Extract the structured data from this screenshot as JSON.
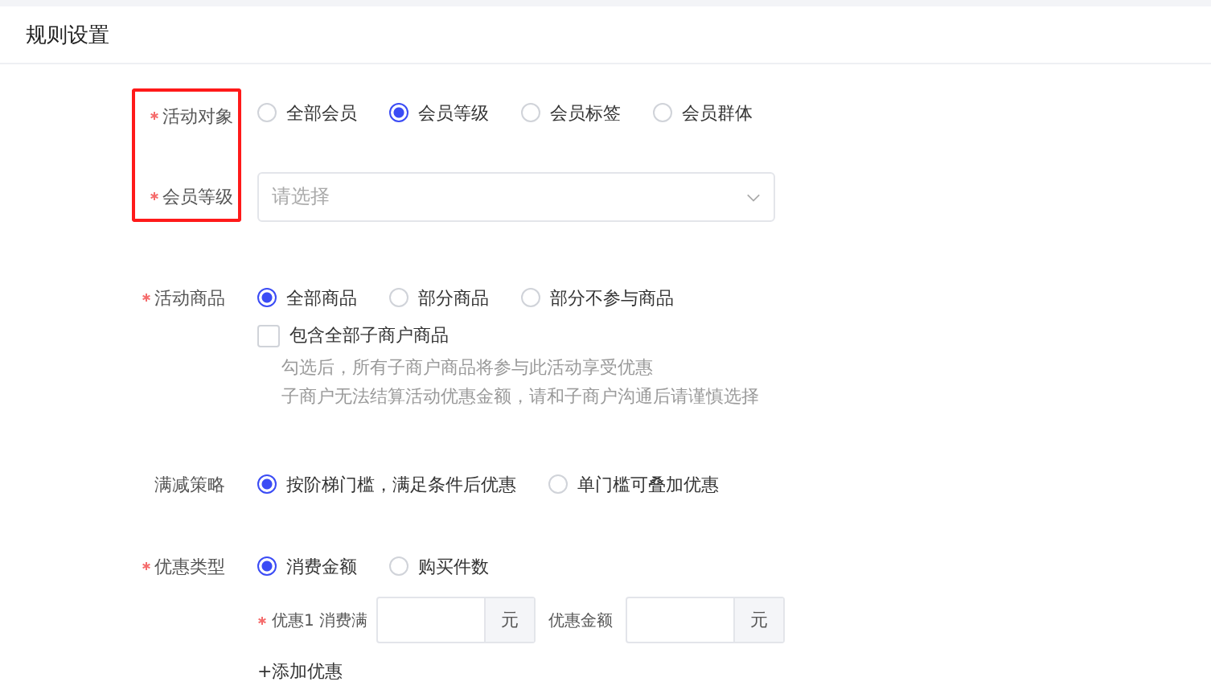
{
  "title": "规则设置",
  "rows": [
    {
      "kind": "radio",
      "label": "活动对象",
      "required": true,
      "highlighted": true,
      "options": [
        {
          "label": "全部会员",
          "selected": false
        },
        {
          "label": "会员等级",
          "selected": true
        },
        {
          "label": "会员标签",
          "selected": false
        },
        {
          "label": "会员群体",
          "selected": false
        }
      ]
    },
    {
      "kind": "select",
      "label": "会员等级",
      "required": true,
      "highlighted": true,
      "placeholder": "请选择"
    },
    {
      "kind": "radio",
      "label": "活动商品",
      "required": true,
      "highlighted": false,
      "options": [
        {
          "label": "全部商品",
          "selected": true
        },
        {
          "label": "部分商品",
          "selected": false
        },
        {
          "label": "部分不参与商品",
          "selected": false
        }
      ],
      "checkbox": {
        "label": "包含全部子商户商品",
        "checked": false
      },
      "hints": [
        "勾选后，所有子商户商品将参与此活动享受优惠",
        "子商户无法结算活动优惠金额，请和子商户沟通后请谨慎选择"
      ]
    },
    {
      "kind": "radio",
      "label": "满减策略",
      "required": false,
      "highlighted": false,
      "options": [
        {
          "label": "按阶梯门槛，满足条件后优惠",
          "selected": true
        },
        {
          "label": "单门槛可叠加优惠",
          "selected": false
        }
      ]
    },
    {
      "kind": "radio",
      "label": "优惠类型",
      "required": true,
      "highlighted": false,
      "options": [
        {
          "label": "消费金额",
          "selected": true
        },
        {
          "label": "购买件数",
          "selected": false
        }
      ],
      "tiers": [
        {
          "required": true,
          "label": "优惠1 消费满",
          "unit": "元",
          "amount_label": "优惠金额",
          "amount_unit": "元"
        }
      ],
      "add_link": "+添加优惠"
    }
  ]
}
